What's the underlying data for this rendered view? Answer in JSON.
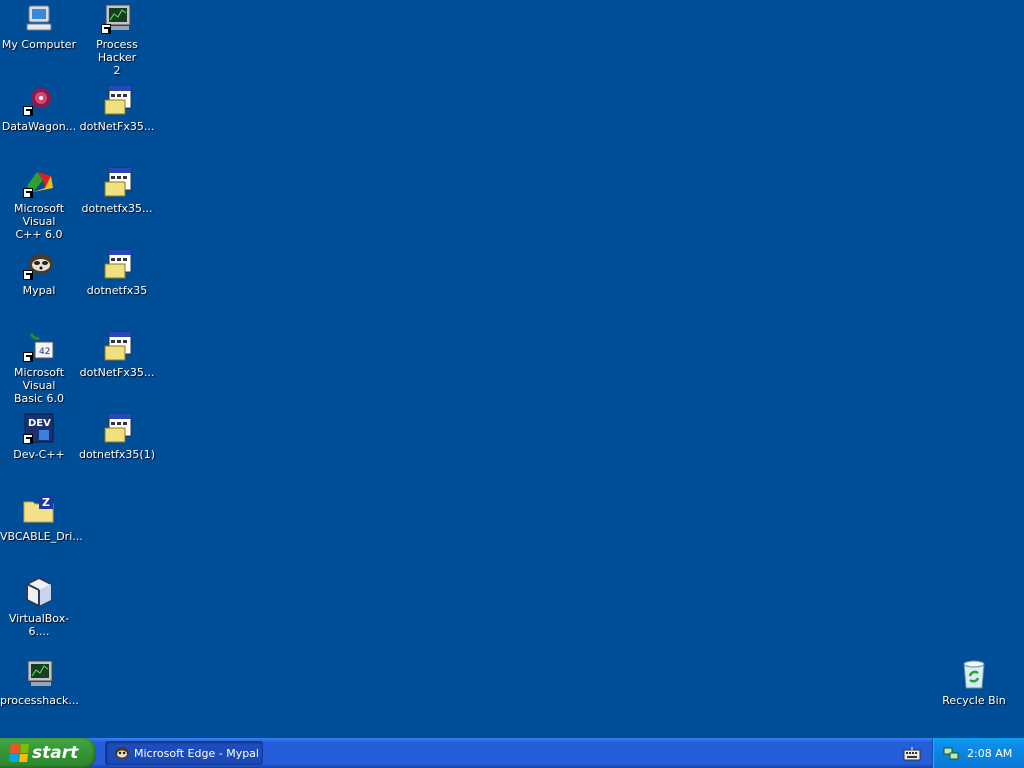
{
  "desktop": {
    "background_color": "#004e98",
    "icons": [
      {
        "label": "My Computer",
        "icon": "my-computer-icon"
      },
      {
        "label": "Process Hacker\n2",
        "icon": "process-hacker-icon"
      },
      {
        "label": "DataWagon...",
        "icon": "datawagon-icon"
      },
      {
        "label": "dotNetFx35...",
        "icon": "installer-icon"
      },
      {
        "label": "Microsoft Visual\nC++ 6.0",
        "icon": "visual-cpp-icon"
      },
      {
        "label": "dotnetfx35...",
        "icon": "installer-icon"
      },
      {
        "label": "Mypal",
        "icon": "mypal-icon"
      },
      {
        "label": "dotnetfx35",
        "icon": "installer-icon"
      },
      {
        "label": "Microsoft Visual\nBasic 6.0",
        "icon": "visual-basic-icon"
      },
      {
        "label": "dotNetFx35...",
        "icon": "installer-icon"
      },
      {
        "label": "Dev-C++",
        "icon": "dev-cpp-icon"
      },
      {
        "label": "dotnetfx35(1)",
        "icon": "installer-icon"
      },
      {
        "label": "VBCABLE_Dri...",
        "icon": "zip-folder-icon"
      },
      {
        "label": "VirtualBox-6....",
        "icon": "virtualbox-icon"
      },
      {
        "label": "processhack...",
        "icon": "process-hacker-icon"
      },
      {
        "label": "Recycle Bin",
        "icon": "recycle-bin-icon"
      }
    ]
  },
  "taskbar": {
    "start_label": "start",
    "task_button_label": "Microsoft Edge - Mypal",
    "clock": "2:08 AM"
  }
}
